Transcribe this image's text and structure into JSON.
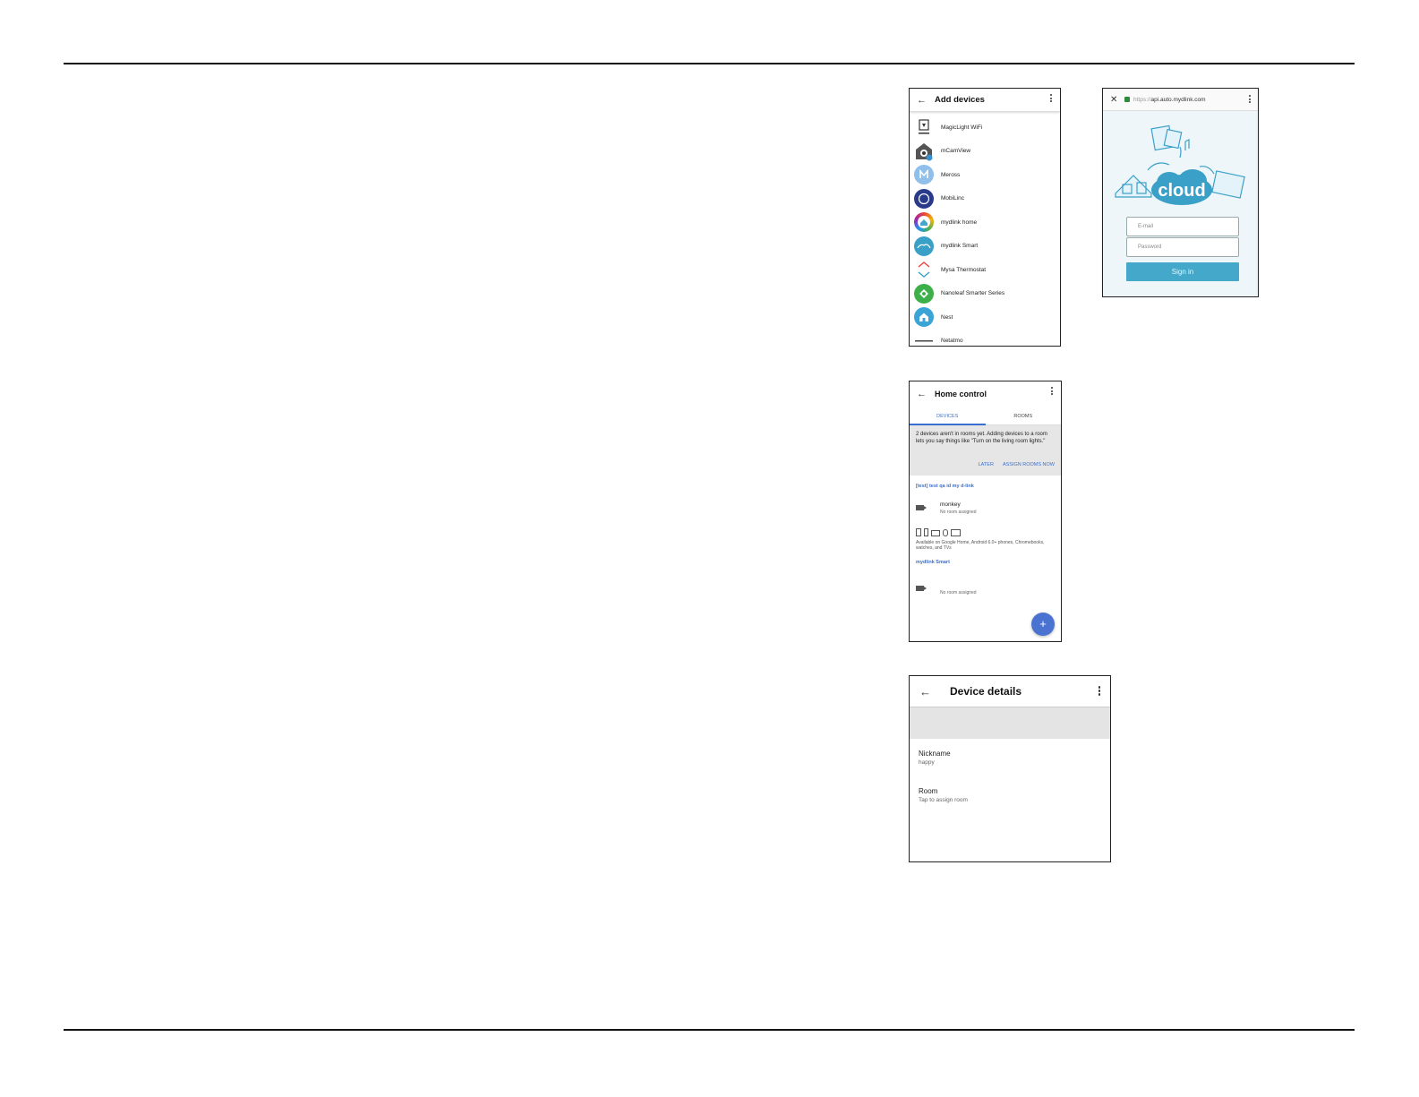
{
  "add_devices": {
    "title": "Add devices",
    "back_icon": "←",
    "items": [
      {
        "label": "MagicLight WiFi",
        "icon": "magiclight-logo",
        "color": "#ffffff"
      },
      {
        "label": "mCamView",
        "icon": "mcamview-logo",
        "color": "#555555"
      },
      {
        "label": "Meross",
        "icon": "meross-logo",
        "color": "#8fbfea"
      },
      {
        "label": "MobiLinc",
        "icon": "mobilinc-logo",
        "color": "#2a3a8a"
      },
      {
        "label": "mydlink home",
        "icon": "mydlink-home-logo",
        "color": "#46a6c9"
      },
      {
        "label": "mydlink Smart",
        "icon": "mydlink-smart-logo",
        "color": "#3aa0c8"
      },
      {
        "label": "Mysa Thermostat",
        "icon": "mysa-logo",
        "color": "#ffffff"
      },
      {
        "label": "Nanoleaf Smarter Series",
        "icon": "nanoleaf-logo",
        "color": "#3db04a"
      },
      {
        "label": "Nest",
        "icon": "nest-logo",
        "color": "#3ba4d6"
      },
      {
        "label": "Netatmo",
        "icon": "netatmo-logo",
        "color": "#ffffff"
      }
    ]
  },
  "signin": {
    "close_icon": "✕",
    "url_proto": "https://",
    "url_host": "api.auto.mydlink.com",
    "email_placeholder": "E-mail",
    "password_placeholder": "Password",
    "signin_label": "Sign in",
    "accent": "#43a8c9"
  },
  "home_control": {
    "title": "Home control",
    "back_icon": "←",
    "tabs": [
      "DEVICES",
      "ROOMS"
    ],
    "banner_text": "2 devices aren't in rooms yet. Adding devices to a room lets you say things like \"Turn on the living room lights.\"",
    "banner_later": "LATER",
    "banner_assign": "ASSIGN ROOMS NOW",
    "section1": "[test] test qa id my d-link",
    "device1_name": "monkey",
    "device1_sub": "No room assigned",
    "available_text": "Available on Google Home, Android 6.0+ phones, Chromebooks, watches, and TVs",
    "section2": "mydlink Smart",
    "device2_sub": "No room assigned",
    "fab_icon": "+",
    "accent": "#3b6fcf"
  },
  "device_details": {
    "title": "Device details",
    "back_icon": "←",
    "nickname_label": "Nickname",
    "nickname_value": "happy",
    "room_label": "Room",
    "room_value": "Tap to assign room"
  }
}
